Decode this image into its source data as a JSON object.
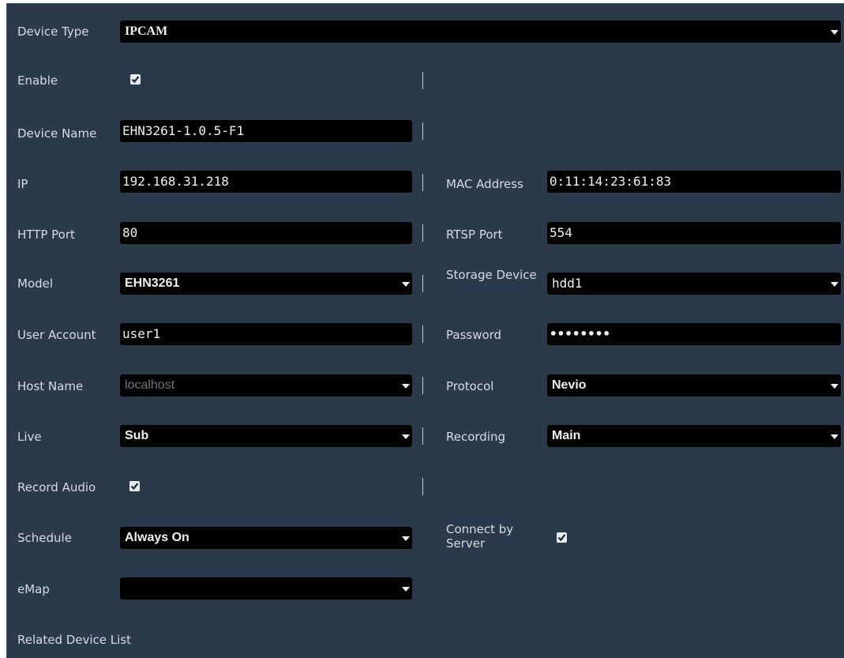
{
  "device_type": {
    "label": "Device Type",
    "value": "IPCAM"
  },
  "enable": {
    "label": "Enable",
    "checked": true
  },
  "device_name": {
    "label": "Device Name",
    "value": "EHN3261-1.0.5-F1"
  },
  "ip": {
    "label": "IP",
    "value": "192.168.31.218"
  },
  "mac_address": {
    "label": "MAC Address",
    "value": "0:11:14:23:61:83"
  },
  "http_port": {
    "label": "HTTP Port",
    "value": "80"
  },
  "rtsp_port": {
    "label": "RTSP Port",
    "value": "554"
  },
  "model": {
    "label": "Model",
    "value": "EHN3261"
  },
  "storage_device": {
    "label": "Storage Device",
    "value": "hdd1"
  },
  "user_account": {
    "label": "User Account",
    "value": "user1"
  },
  "password": {
    "label": "Password",
    "value": "••••••••"
  },
  "host_name": {
    "label": "Host Name",
    "value": "localhost"
  },
  "protocol": {
    "label": "Protocol",
    "value": "Nevio"
  },
  "live": {
    "label": "Live",
    "value": "Sub"
  },
  "recording": {
    "label": "Recording",
    "value": "Main"
  },
  "record_audio": {
    "label": "Record Audio",
    "checked": true
  },
  "schedule": {
    "label": "Schedule",
    "value": "Always On"
  },
  "connect_by_server": {
    "label": "Connect by Server",
    "checked": true
  },
  "emap": {
    "label": "eMap",
    "value": ""
  },
  "related_device_list": {
    "label": "Related Device List"
  },
  "icons": {
    "dropdown": "chevron-down-icon",
    "checkbox": "checkmark-icon"
  },
  "colors": {
    "background": "#2a3a4b",
    "field": "#000000",
    "text": "#d6dce3"
  }
}
